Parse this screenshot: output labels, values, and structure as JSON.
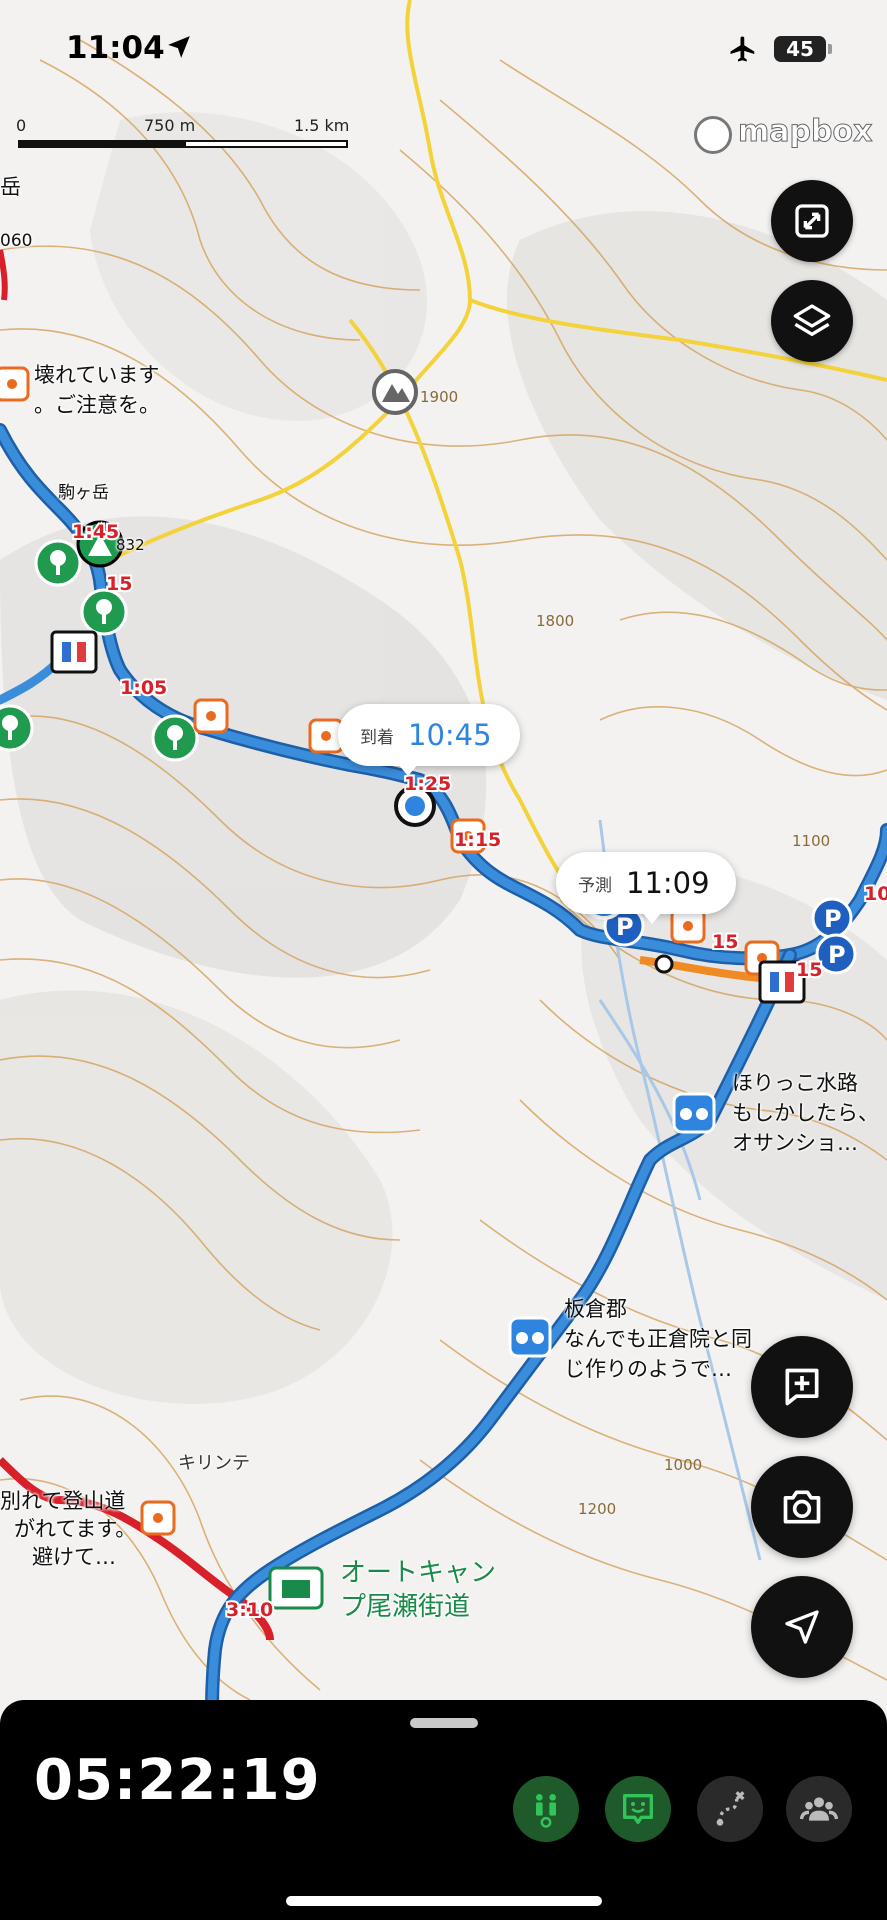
{
  "status_bar": {
    "time": "11:04",
    "battery": "45"
  },
  "scale_bar": {
    "labels": [
      "0",
      "750 m",
      "1.5 km"
    ]
  },
  "attribution": "mapbox",
  "callouts": {
    "arrival": {
      "label": "到着",
      "time": "10:45"
    },
    "predicted": {
      "label": "予測",
      "time": "11:09"
    }
  },
  "map_labels": {
    "broken_note": [
      "壊れています",
      "。ご注意を。"
    ],
    "komagatake": "駒ヶ岳",
    "peak_partial": "岳",
    "elev_060": "060",
    "elev_832": "832",
    "horikko": [
      "ほりっこ水路",
      "もしかしたら、",
      "オサンショ…"
    ],
    "itakura": [
      "板倉郡",
      "なんでも正倉院と同",
      "じ作りのようで…"
    ],
    "kirinte": "キリンテ",
    "trail_note": [
      "別れて登山道",
      "がれてます。",
      "避けて…"
    ],
    "campsite": [
      "オートキャン",
      "プ尾瀬街道"
    ],
    "contours": [
      "1800",
      "1100",
      "1000",
      "1200",
      "1900"
    ]
  },
  "route_times": [
    "1:45",
    "15",
    "1:05",
    "1:25",
    "1:15",
    "15",
    "15",
    "3:10",
    "10"
  ],
  "bottom_panel": {
    "elapsed_time": "05:22:19"
  },
  "colors": {
    "route_blue": "#3a8ddb",
    "route_red": "#d8202a",
    "trail_yellow": "#f3d23a",
    "contour": "#d4a15a",
    "accent_green": "#32c35a"
  }
}
